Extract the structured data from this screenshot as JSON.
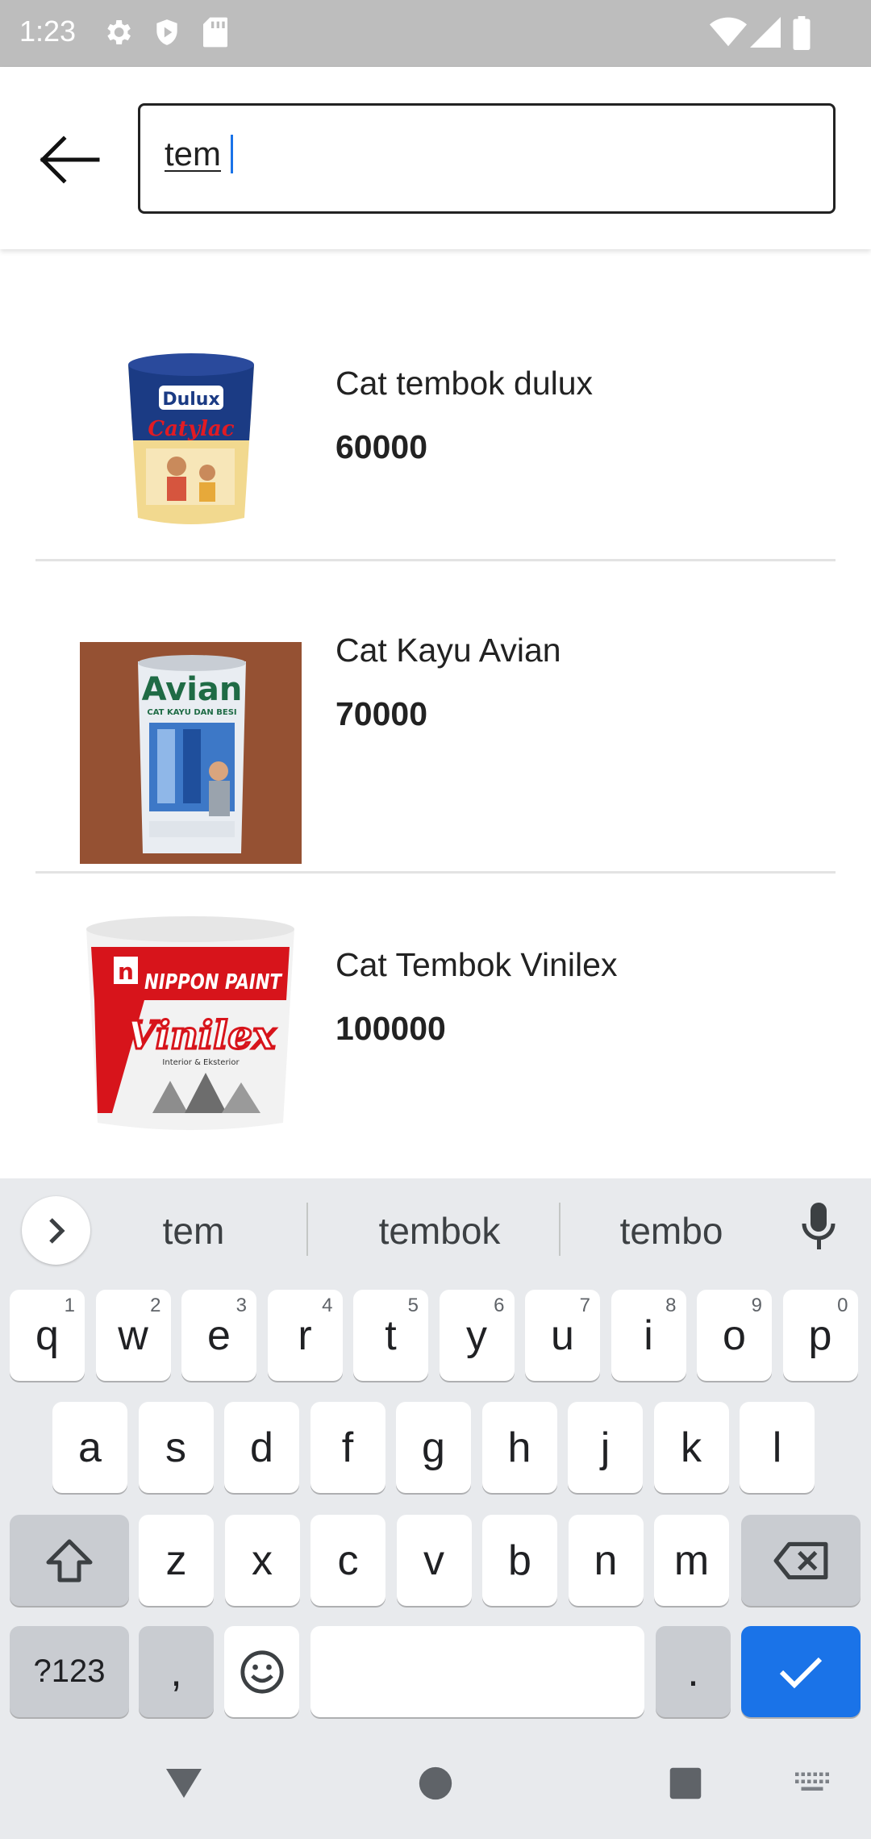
{
  "status_bar": {
    "time": "1:23",
    "icons": [
      "settings-icon",
      "shield-icon",
      "sd-card-icon",
      "wifi-icon",
      "signal-icon",
      "battery-icon"
    ]
  },
  "header": {
    "back_icon": "arrow-left-icon",
    "search": {
      "value": "tem",
      "placeholder": ""
    }
  },
  "products": [
    {
      "name": "Cat tembok dulux",
      "price": "60000",
      "image": "Dulux Catylac paint bucket"
    },
    {
      "name": "Cat Kayu Avian",
      "price": "70000",
      "image": "Avian Cat Kayu dan Besi paint can"
    },
    {
      "name": "Cat Tembok Vinilex",
      "price": "100000",
      "image": "Nippon Paint Vinilex paint bucket"
    }
  ],
  "product_image_text": {
    "dulux": {
      "brand": "Dulux",
      "line": "Catylac"
    },
    "avian": {
      "brand": "Avian",
      "sub": "CAT KAYU DAN BESI"
    },
    "vinilex": {
      "brand": "NIPPON PAINT",
      "line": "Vinilex",
      "tag": "Interior & Eksterior"
    }
  },
  "keyboard": {
    "suggestions": [
      "tem",
      "tembok",
      "tembo"
    ],
    "row1": [
      {
        "key": "q",
        "hint": "1"
      },
      {
        "key": "w",
        "hint": "2"
      },
      {
        "key": "e",
        "hint": "3"
      },
      {
        "key": "r",
        "hint": "4"
      },
      {
        "key": "t",
        "hint": "5"
      },
      {
        "key": "y",
        "hint": "6"
      },
      {
        "key": "u",
        "hint": "7"
      },
      {
        "key": "i",
        "hint": "8"
      },
      {
        "key": "o",
        "hint": "9"
      },
      {
        "key": "p",
        "hint": "0"
      }
    ],
    "row2": [
      "a",
      "s",
      "d",
      "f",
      "g",
      "h",
      "j",
      "k",
      "l"
    ],
    "row3": [
      "z",
      "x",
      "c",
      "v",
      "b",
      "n",
      "m"
    ],
    "symbols_label": "?123",
    "comma": ",",
    "period": ".",
    "accent_color": "#1a73e8"
  },
  "nav_bar": {
    "icons": [
      "back-triangle-icon",
      "home-circle-icon",
      "recents-square-icon",
      "keyboard-switch-icon"
    ]
  }
}
